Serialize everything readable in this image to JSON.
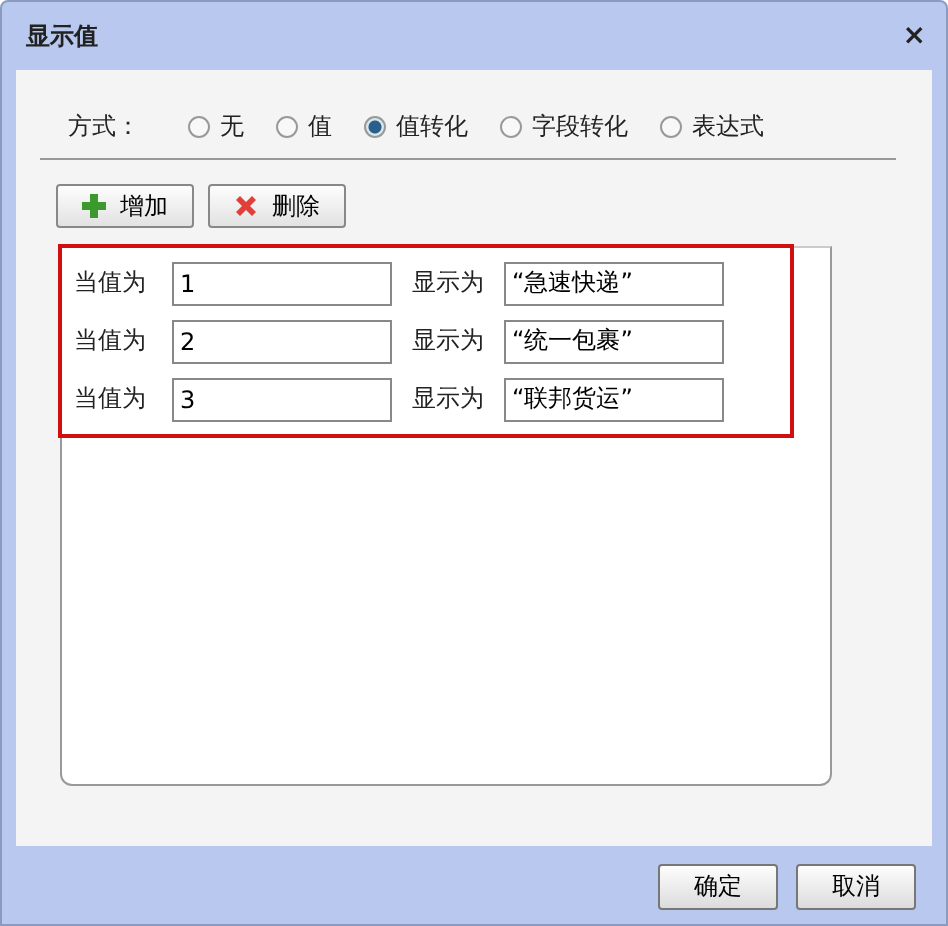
{
  "window": {
    "title": "显示值",
    "close": "×"
  },
  "mode": {
    "label": "方式：",
    "options": [
      {
        "label": "无",
        "selected": false
      },
      {
        "label": "值",
        "selected": false
      },
      {
        "label": "值转化",
        "selected": true
      },
      {
        "label": "字段转化",
        "selected": false
      },
      {
        "label": "表达式",
        "selected": false
      }
    ]
  },
  "toolbar": [
    {
      "kind": "add",
      "label": "增加"
    },
    {
      "kind": "delete",
      "label": "删除"
    }
  ],
  "rows": [
    {
      "value_label": "当值为",
      "value": "1",
      "display_label": "显示为",
      "display": "“急速快递”"
    },
    {
      "value_label": "当值为",
      "value": "2",
      "display_label": "显示为",
      "display": "“统一包裹”"
    },
    {
      "value_label": "当值为",
      "value": "3",
      "display_label": "显示为",
      "display": "“联邦货运”"
    }
  ],
  "buttons": [
    "确定",
    "取消"
  ]
}
